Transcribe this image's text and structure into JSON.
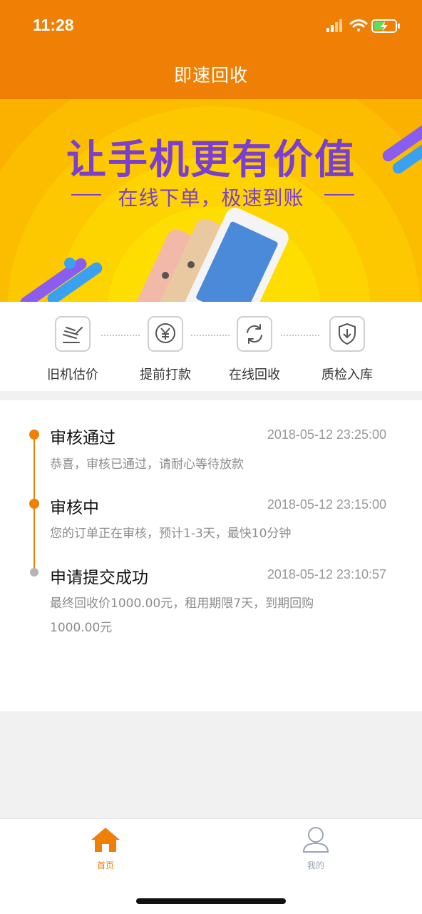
{
  "status": {
    "time": "11:28"
  },
  "nav": {
    "title": "即速回收"
  },
  "banner": {
    "headline": "让手机更有价值",
    "subline": "在线下单，极速到账"
  },
  "steps": [
    {
      "label": "旧机估价",
      "icon": "gavel-icon"
    },
    {
      "label": "提前打款",
      "icon": "yen-coin-icon"
    },
    {
      "label": "在线回收",
      "icon": "refresh-icon"
    },
    {
      "label": "质检入库",
      "icon": "shield-download-icon"
    }
  ],
  "timeline": [
    {
      "title": "审核通过",
      "time": "2018-05-12 23:25:00",
      "desc": "恭喜，审核已通过，请耐心等待放款",
      "state": "active"
    },
    {
      "title": "审核中",
      "time": "2018-05-12 23:15:00",
      "desc": "您的订单正在审核，预计1-3天，最快10分钟",
      "state": "active"
    },
    {
      "title": "申请提交成功",
      "time": "2018-05-12 23:10:57",
      "desc_line1": "最终回收价1000.00元，租用期限7天，到期回购",
      "desc_line2": "1000.00元",
      "state": "done"
    }
  ],
  "tabbar": {
    "home": {
      "label": "首页",
      "icon": "home-icon",
      "active": true
    },
    "mine": {
      "label": "我的",
      "icon": "user-icon",
      "active": false
    }
  },
  "colors": {
    "accent": "#f07f06",
    "banner_bg": "#fbb400",
    "headline": "#7b3fd0",
    "inactive_tab": "#9aa3b5"
  }
}
